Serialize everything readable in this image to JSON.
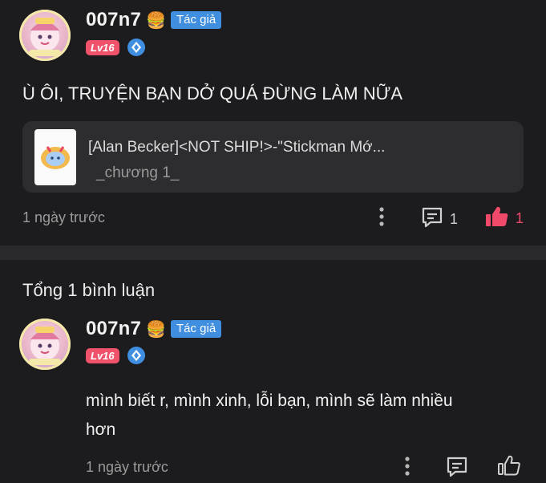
{
  "comment": {
    "username": "007n7",
    "name_emoji": "🍔",
    "author_badge": "Tác giả",
    "level_badge": "Lv16",
    "text": "Ù ÔI, TRUYỆN BẠN DỞ QUÁ ĐỪNG LÀM NỮA",
    "story_card": {
      "title": "[Alan Becker]<NOT SHIP!>-\"Stickman Mớ...",
      "chapter": "_chương 1_"
    },
    "time": "1 ngày trước",
    "reply_count": "1",
    "like_count": "1"
  },
  "section": {
    "title": "Tổng 1 bình luận"
  },
  "reply": {
    "username": "007n7",
    "name_emoji": "🍔",
    "author_badge": "Tác giả",
    "level_badge": "Lv16",
    "text_line1": "mình biết r, mình xinh, lỗi bạn, mình sẽ làm nhiều",
    "text_line2": "hơn",
    "time": "1 ngày trước"
  },
  "colors": {
    "background": "#1c1c1e",
    "card": "#2d2d2f",
    "author_badge": "#3f8ee0",
    "level_badge": "#f1526b",
    "like_active": "#f04a6a"
  },
  "icons": [
    "avatar",
    "verified-diamond-icon",
    "more-vertical-icon",
    "comment-icon",
    "thumbs-up-icon"
  ]
}
